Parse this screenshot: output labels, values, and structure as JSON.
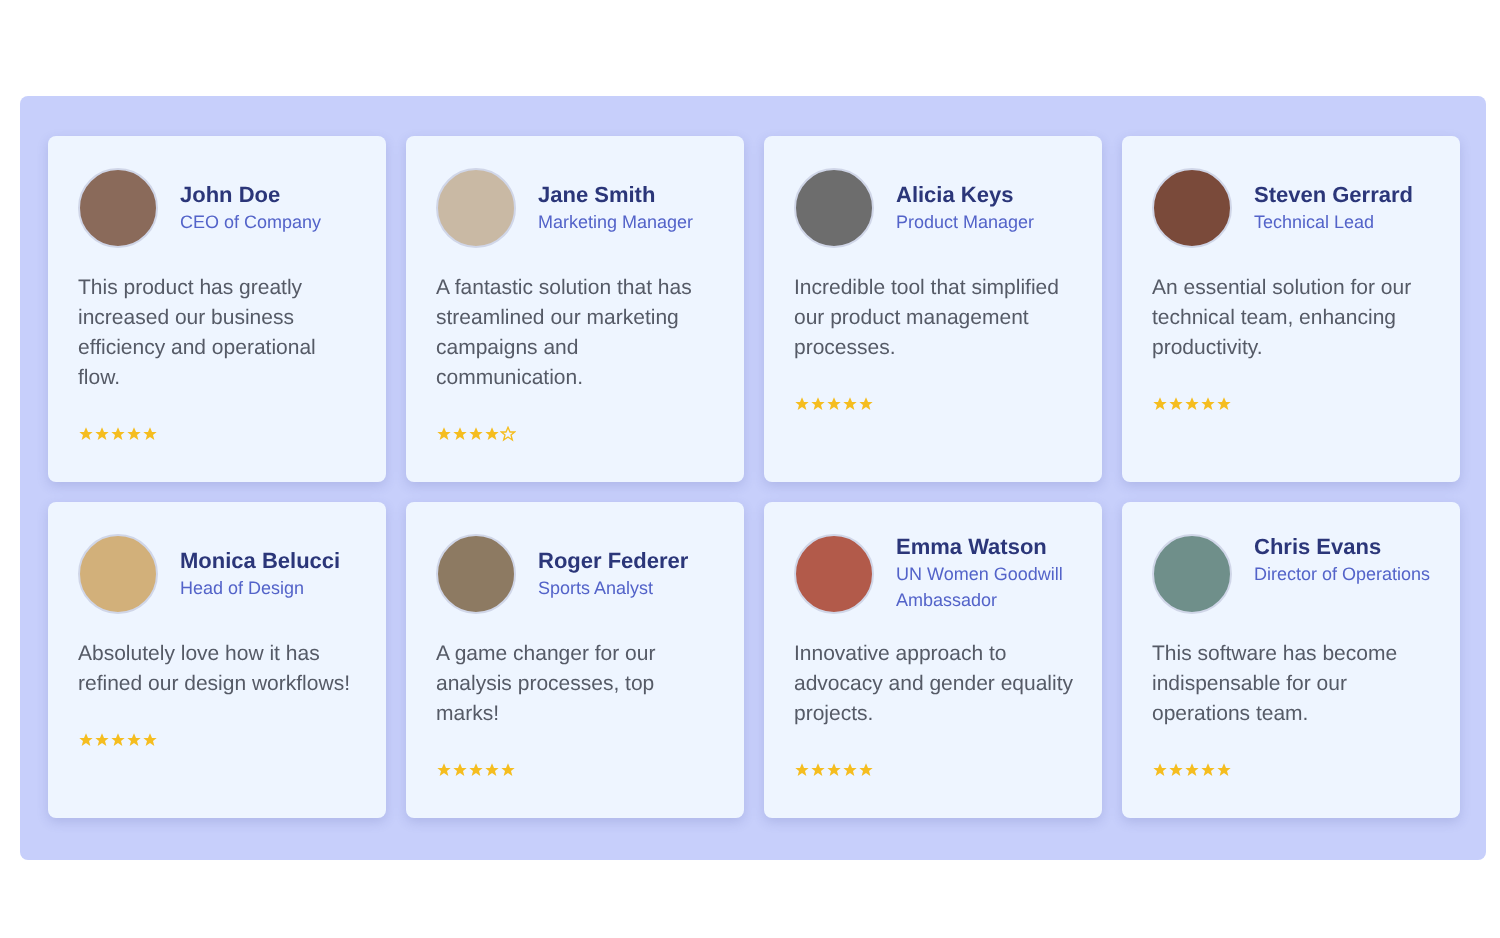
{
  "testimonials": [
    {
      "name": "John Doe",
      "role": "CEO of Company",
      "text": "This product has greatly increased our business efficiency and operational flow.",
      "stars": 5
    },
    {
      "name": "Jane Smith",
      "role": "Marketing Manager",
      "text": "A fantastic solution that has streamlined our marketing campaigns and communication.",
      "stars": 4
    },
    {
      "name": "Alicia Keys",
      "role": "Product Manager",
      "text": "Incredible tool that simplified our product management processes.",
      "stars": 5
    },
    {
      "name": "Steven Gerrard",
      "role": "Technical Lead",
      "text": "An essential solution for our technical team, enhancing productivity.",
      "stars": 5
    },
    {
      "name": "Monica Belucci",
      "role": "Head of Design",
      "text": "Absolutely love how it has refined our design workflows!",
      "stars": 5
    },
    {
      "name": "Roger Federer",
      "role": "Sports Analyst",
      "text": "A game changer for our analysis processes, top marks!",
      "stars": 5
    },
    {
      "name": "Emma Watson",
      "role": "UN Women Goodwill Ambassador",
      "text": "Innovative approach to advocacy and gender equality projects.",
      "stars": 5
    },
    {
      "name": "Chris Evans",
      "role": "Director of Operations",
      "text": "This software has become indispensable for our operations team.",
      "stars": 5
    }
  ]
}
